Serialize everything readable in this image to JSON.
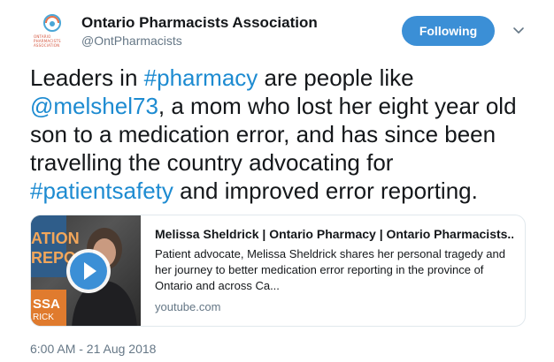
{
  "account": {
    "name": "Ontario Pharmacists Association",
    "handle": "@OntPharmacists",
    "avatar_lines": [
      "ONTARIO",
      "PHARMACISTS",
      "ASSOCIATION"
    ]
  },
  "follow_button": {
    "label": "Following"
  },
  "tweet": {
    "segments": [
      {
        "text": "Leaders in ",
        "type": "text"
      },
      {
        "text": "#pharmacy",
        "type": "link"
      },
      {
        "text": " are people like ",
        "type": "text"
      },
      {
        "text": "@melshel73",
        "type": "link"
      },
      {
        "text": ", a mom who lost her eight year old son to a medication error, and has since been travelling the country advocating for ",
        "type": "text"
      },
      {
        "text": "#patientsafety",
        "type": "link"
      },
      {
        "text": " and improved error reporting.",
        "type": "text"
      }
    ]
  },
  "card": {
    "title": "Melissa Sheldrick | Ontario Pharmacy | Ontario Pharmacists...",
    "description": "Patient advocate, Melissa Sheldrick shares her personal tragedy and her journey to better medication error reporting in the province of Ontario and across Ca...",
    "domain": "youtube.com",
    "thumb_text_top_1": "ATION",
    "thumb_text_top_2": "REPO",
    "thumb_text_bottom_1": "SSA",
    "thumb_text_bottom_2": "RICK"
  },
  "timestamp": "6:00 AM - 21 Aug 2018",
  "colors": {
    "link": "#1d8bd1",
    "follow_button": "#3b8fd6",
    "secondary_text": "#657786"
  }
}
